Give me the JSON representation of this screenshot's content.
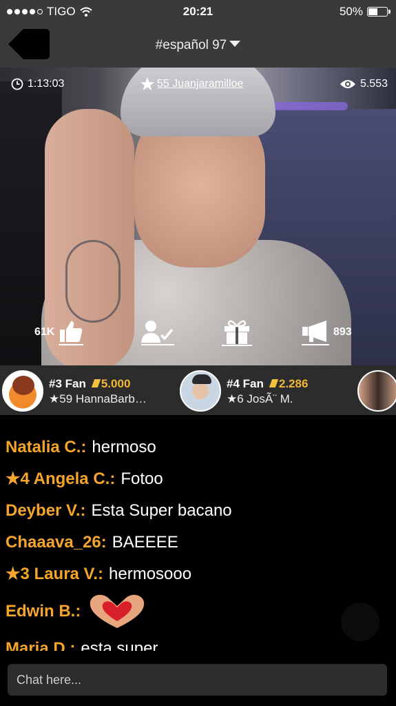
{
  "status_bar": {
    "carrier": "TIGO",
    "time": "20:21",
    "battery": "50%",
    "battery_level": 0.5,
    "signal_bars": 4,
    "signal_total": 5
  },
  "nav": {
    "title": "#español 97",
    "back_icon": "back-arrow-icon",
    "dropdown_icon": "caret-down-icon"
  },
  "stream": {
    "duration": "1:13:03",
    "streamer_level": "55",
    "streamer_name": "Juanjaramilloe",
    "viewers": "5.553",
    "likes": "61K",
    "shares": "893"
  },
  "fans": [
    {
      "rank": "#3 Fan",
      "coins": "5.000",
      "user": "★59 HannaBarb…"
    },
    {
      "rank": "#4 Fan",
      "coins": "2.286",
      "user": "★6 JosÃ¨ M."
    }
  ],
  "chat": [
    {
      "user": "Natalia C.:",
      "text": "hermoso"
    },
    {
      "user": "★4 Angela C.:",
      "text": "Fotoo"
    },
    {
      "user": "Deyber V.:",
      "text": "Esta Super bacano"
    },
    {
      "user": "Chaaava_26:",
      "text": "BAEEEE"
    },
    {
      "user": "★3 Laura V.:",
      "text": "hermosooo"
    },
    {
      "user": "Edwin B.:",
      "text": "",
      "emoji": "heart-hands-icon"
    },
    {
      "user": "Maria D.:",
      "text": "esta super"
    }
  ],
  "chat_input": {
    "placeholder": "Chat here..."
  },
  "colors": {
    "accent": "#f6a52c",
    "bar": "#3a3a3a",
    "panel": "#2c2c2c"
  }
}
